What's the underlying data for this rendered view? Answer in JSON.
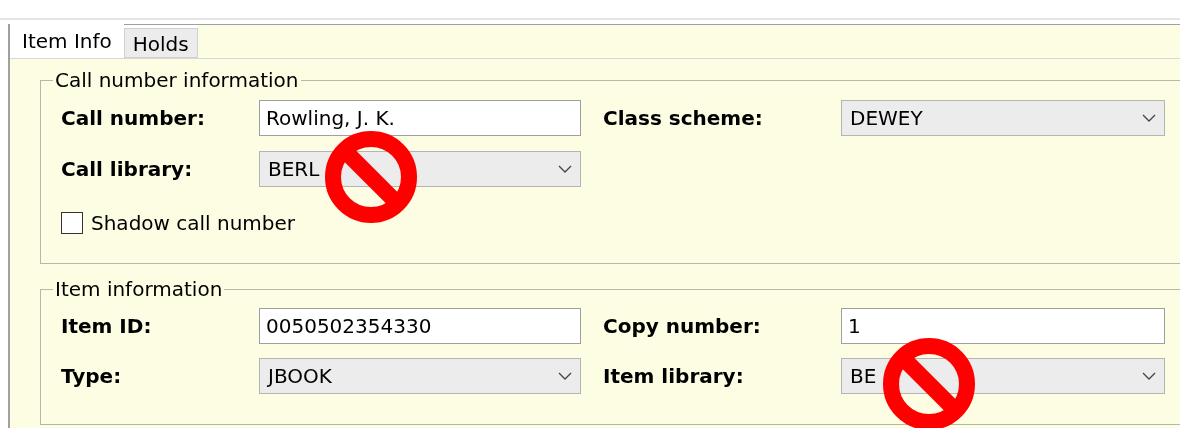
{
  "tabs": [
    {
      "label": "Item Info",
      "selected": true
    },
    {
      "label": "Holds",
      "selected": false
    }
  ],
  "call_number_group": {
    "title": "Call number information",
    "call_number": {
      "label": "Call number:",
      "value": "Rowling, J. K."
    },
    "class_scheme": {
      "label": "Class scheme:",
      "value": "DEWEY"
    },
    "call_library": {
      "label": "Call library:",
      "value": "BERL",
      "blocked": true
    },
    "shadow": {
      "label": "Shadow call number",
      "checked": false
    }
  },
  "item_group": {
    "title": "Item information",
    "item_id": {
      "label": "Item ID:",
      "value": "0050502354330"
    },
    "copy_number": {
      "label": "Copy number:",
      "value": "1"
    },
    "type": {
      "label": "Type:",
      "value": "JBOOK"
    },
    "item_library": {
      "label": "Item library:",
      "value": "BE",
      "blocked": true
    }
  }
}
